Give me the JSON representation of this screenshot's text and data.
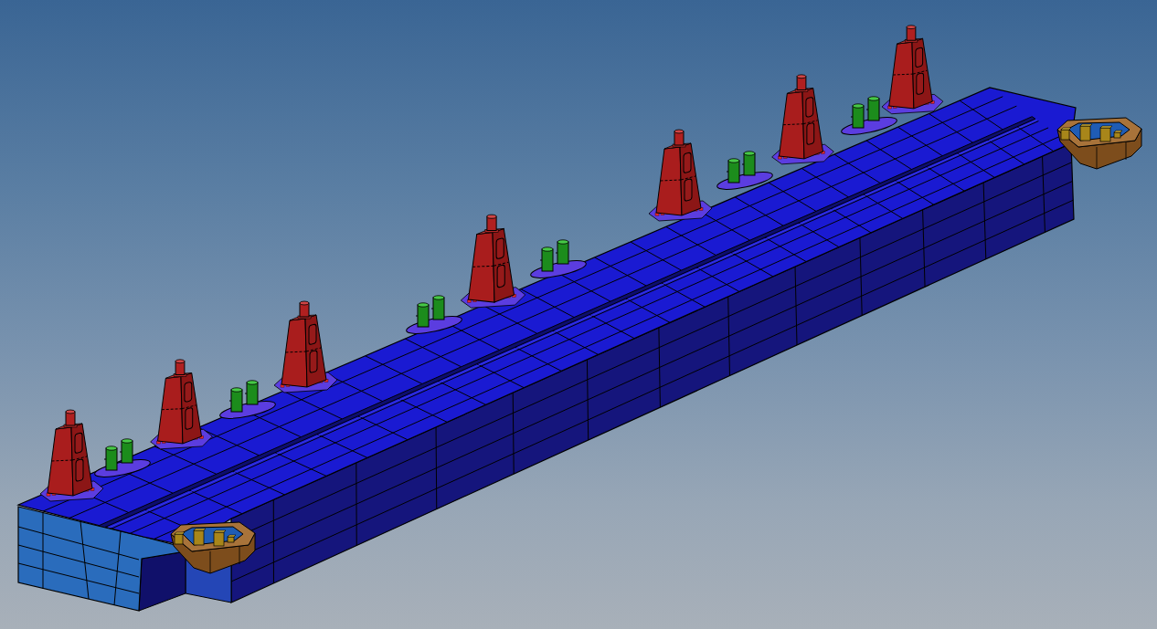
{
  "viewport": {
    "parts": [
      {
        "kind": "beam"
      },
      {
        "kind": "pedestal"
      },
      {
        "kind": "mount"
      },
      {
        "kind": "pedestal"
      },
      {
        "kind": "block"
      },
      {
        "kind": "mount"
      },
      {
        "kind": "pedestal"
      },
      {
        "kind": "mount"
      },
      {
        "kind": "pedestal"
      },
      {
        "kind": "mount"
      },
      {
        "kind": "pedestal"
      },
      {
        "kind": "mount"
      },
      {
        "kind": "pedestal"
      },
      {
        "kind": "mount"
      },
      {
        "kind": "pedestal"
      },
      {
        "kind": "block"
      }
    ]
  }
}
